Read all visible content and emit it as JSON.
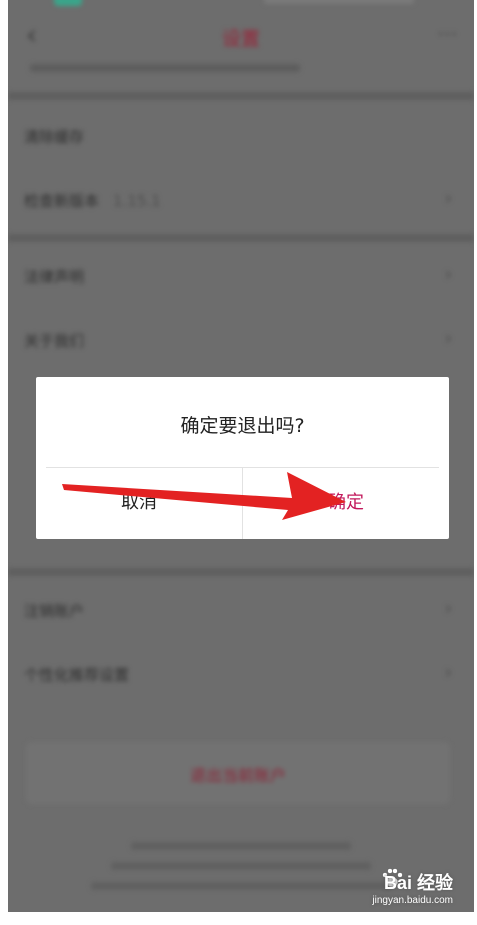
{
  "navbar": {
    "title": "设置",
    "back_icon": "chevron-left-icon",
    "more_icon": "more-dots-icon"
  },
  "settings": {
    "group1": [
      {
        "label": "清除缓存",
        "value": ""
      },
      {
        "label": "检查新版本",
        "value": "1.15.1"
      }
    ],
    "group2": [
      {
        "label": "法律声明"
      },
      {
        "label": "关于我们"
      }
    ],
    "group3": [
      {
        "label": "注销账户"
      },
      {
        "label": "个性化推荐设置"
      }
    ]
  },
  "logout_button": {
    "label": "退出当前账户"
  },
  "dialog": {
    "message": "确定要退出吗?",
    "cancel_label": "取消",
    "confirm_label": "确定"
  },
  "annotation": {
    "type": "red-arrow",
    "color": "#e32222",
    "points_to": "confirm-button"
  },
  "watermark": {
    "logo": "Bai  经验",
    "url": "jingyan.baidu.com"
  },
  "colors": {
    "overlay": "#6d6d6d",
    "accent": "#c2185b",
    "arrow": "#e32222"
  }
}
